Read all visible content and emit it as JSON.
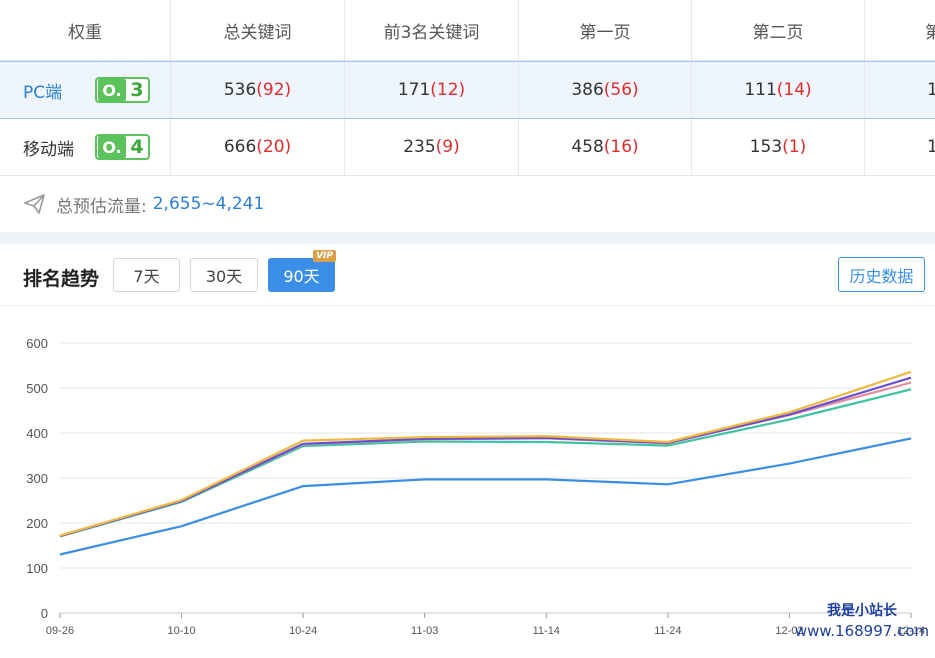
{
  "table": {
    "headers": [
      "权重",
      "总关键词",
      "前3名关键词",
      "第一页",
      "第二页",
      "第"
    ],
    "rows": [
      {
        "label": "PC端",
        "weight": "3",
        "cells": [
          {
            "main": "536",
            "sub": "(92)"
          },
          {
            "main": "171",
            "sub": "(12)"
          },
          {
            "main": "386",
            "sub": "(56)"
          },
          {
            "main": "111",
            "sub": "(14)"
          },
          {
            "main": "1",
            "sub": ""
          }
        ]
      },
      {
        "label": "移动端",
        "weight": "4",
        "cells": [
          {
            "main": "666",
            "sub": "(20)"
          },
          {
            "main": "235",
            "sub": "(9)"
          },
          {
            "main": "458",
            "sub": "(16)"
          },
          {
            "main": "153",
            "sub": "(1)"
          },
          {
            "main": "1",
            "sub": ""
          }
        ]
      }
    ]
  },
  "traffic": {
    "label": "总预估流量:",
    "value": "2,655~4,241"
  },
  "trend": {
    "title": "排名趋势",
    "ranges": [
      "7天",
      "30天",
      "90天"
    ],
    "active_range": "90天",
    "vip_label": "VIP",
    "history_button": "历史数据"
  },
  "watermark": {
    "line1": "我是小站长",
    "line2": "www.168997.com"
  },
  "colors": {
    "accent": "#3a8ee6",
    "highlight_row": "#eef5fd",
    "red": "#e02b2b",
    "weight_green": "#5cc35c"
  },
  "chart_data": {
    "type": "line",
    "x": [
      "09-26",
      "10-10",
      "10-24",
      "11-03",
      "11-14",
      "11-24",
      "12-02",
      "12-14"
    ],
    "ylim": [
      0,
      600
    ],
    "yticks": [
      0,
      100,
      200,
      300,
      400,
      500,
      600
    ],
    "grid": true,
    "series": [
      {
        "color": "#3a8ee6",
        "values": [
          130,
          193,
          282,
          297,
          297,
          286,
          332,
          388
        ]
      },
      {
        "color": "#3fc3a0",
        "values": [
          170,
          247,
          371,
          381,
          380,
          372,
          430,
          497
        ]
      },
      {
        "color": "#e08fa0",
        "values": [
          171,
          249,
          375,
          386,
          388,
          377,
          440,
          512
        ]
      },
      {
        "color": "#6a4fcf",
        "values": [
          171,
          249,
          376,
          387,
          389,
          378,
          441,
          523
        ]
      },
      {
        "color": "#f0b840",
        "values": [
          172,
          251,
          383,
          391,
          393,
          380,
          446,
          536
        ]
      }
    ]
  }
}
